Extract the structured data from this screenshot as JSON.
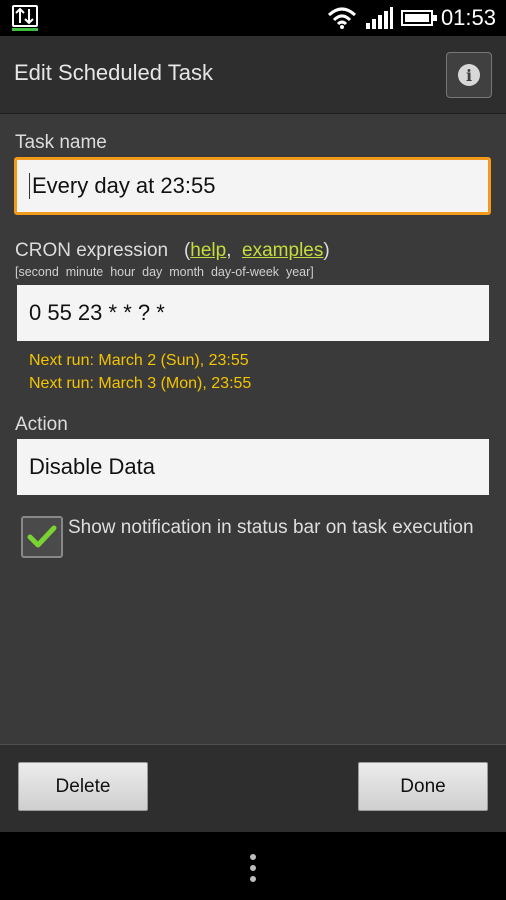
{
  "status_bar": {
    "time": "01:53"
  },
  "action_bar": {
    "title": "Edit Scheduled Task"
  },
  "form": {
    "task_name_label": "Task name",
    "task_name_value": "Every day at 23:55",
    "cron_label": "CRON expression",
    "cron_help_link": "help",
    "cron_examples_link": "examples",
    "cron_hint": "[second  minute  hour  day  month  day-of-week  year]",
    "cron_value": "0 55 23 * * ? *",
    "next_runs": [
      "Next run: March 2 (Sun), 23:55",
      "Next run: March 3 (Mon), 23:55"
    ],
    "action_label": "Action",
    "action_value": "Disable Data",
    "notify_checkbox_checked": true,
    "notify_label": "Show notification in status bar on task execution"
  },
  "buttons": {
    "delete": "Delete",
    "done": "Done"
  },
  "colors": {
    "accent_focus": "#f29a1b",
    "next_run_text": "#f3c400",
    "link": "#c6dc3c",
    "check": "#7bd332"
  }
}
